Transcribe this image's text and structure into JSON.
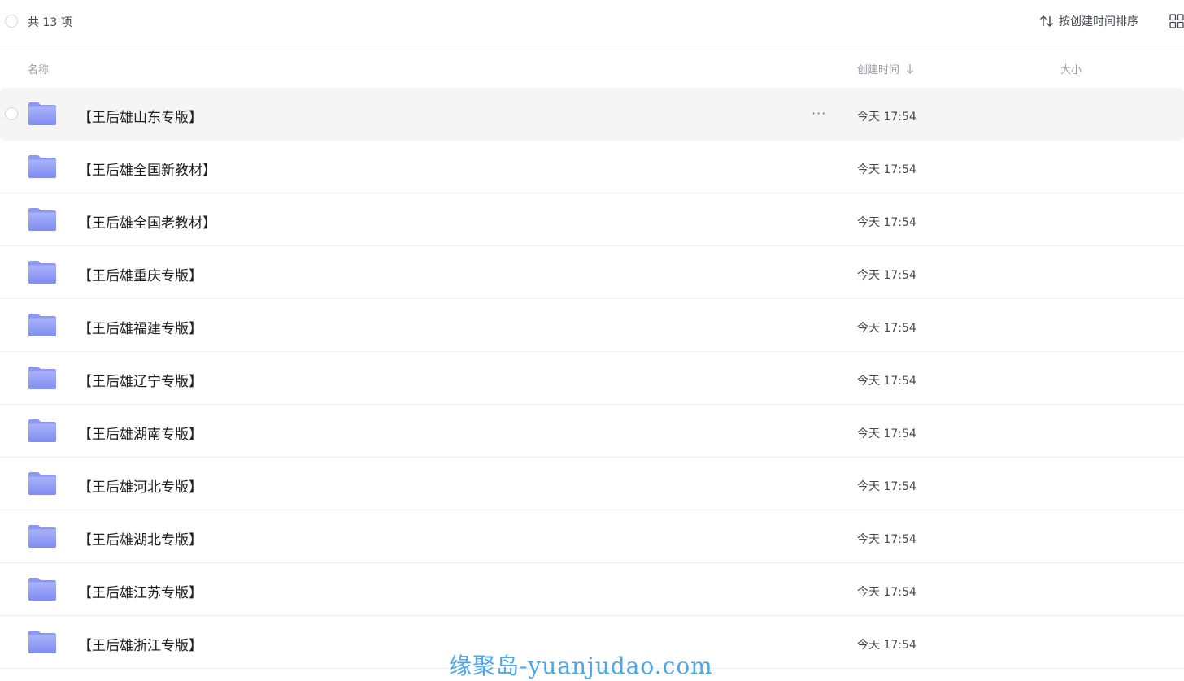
{
  "toolbar": {
    "count_label": "共 13 项",
    "sort_label": "按创建时间排序",
    "sort_icon": "sort-icon",
    "view_icon": "grid-view-icon"
  },
  "columns": {
    "name": "名称",
    "time": "创建时间",
    "size": "大小"
  },
  "files": [
    {
      "name": "【王后雄山东专版】",
      "time": "今天 17:54",
      "size": "",
      "hovered": true
    },
    {
      "name": "【王后雄全国新教材】",
      "time": "今天 17:54",
      "size": ""
    },
    {
      "name": "【王后雄全国老教材】",
      "time": "今天 17:54",
      "size": ""
    },
    {
      "name": "【王后雄重庆专版】",
      "time": "今天 17:54",
      "size": ""
    },
    {
      "name": "【王后雄福建专版】",
      "time": "今天 17:54",
      "size": ""
    },
    {
      "name": "【王后雄辽宁专版】",
      "time": "今天 17:54",
      "size": ""
    },
    {
      "name": "【王后雄湖南专版】",
      "time": "今天 17:54",
      "size": ""
    },
    {
      "name": "【王后雄河北专版】",
      "time": "今天 17:54",
      "size": ""
    },
    {
      "name": "【王后雄湖北专版】",
      "time": "今天 17:54",
      "size": ""
    },
    {
      "name": "【王后雄江苏专版】",
      "time": "今天 17:54",
      "size": ""
    },
    {
      "name": "【王后雄浙江专版】",
      "time": "今天 17:54",
      "size": ""
    }
  ],
  "more_label": "···",
  "watermark": "缘聚岛-yuanjudao.com",
  "colors": {
    "folder_top": "#a9b3f7",
    "folder_bottom": "#7f8cf2",
    "hover_bg": "#f5f5f6",
    "watermark": "#4da6e8"
  }
}
